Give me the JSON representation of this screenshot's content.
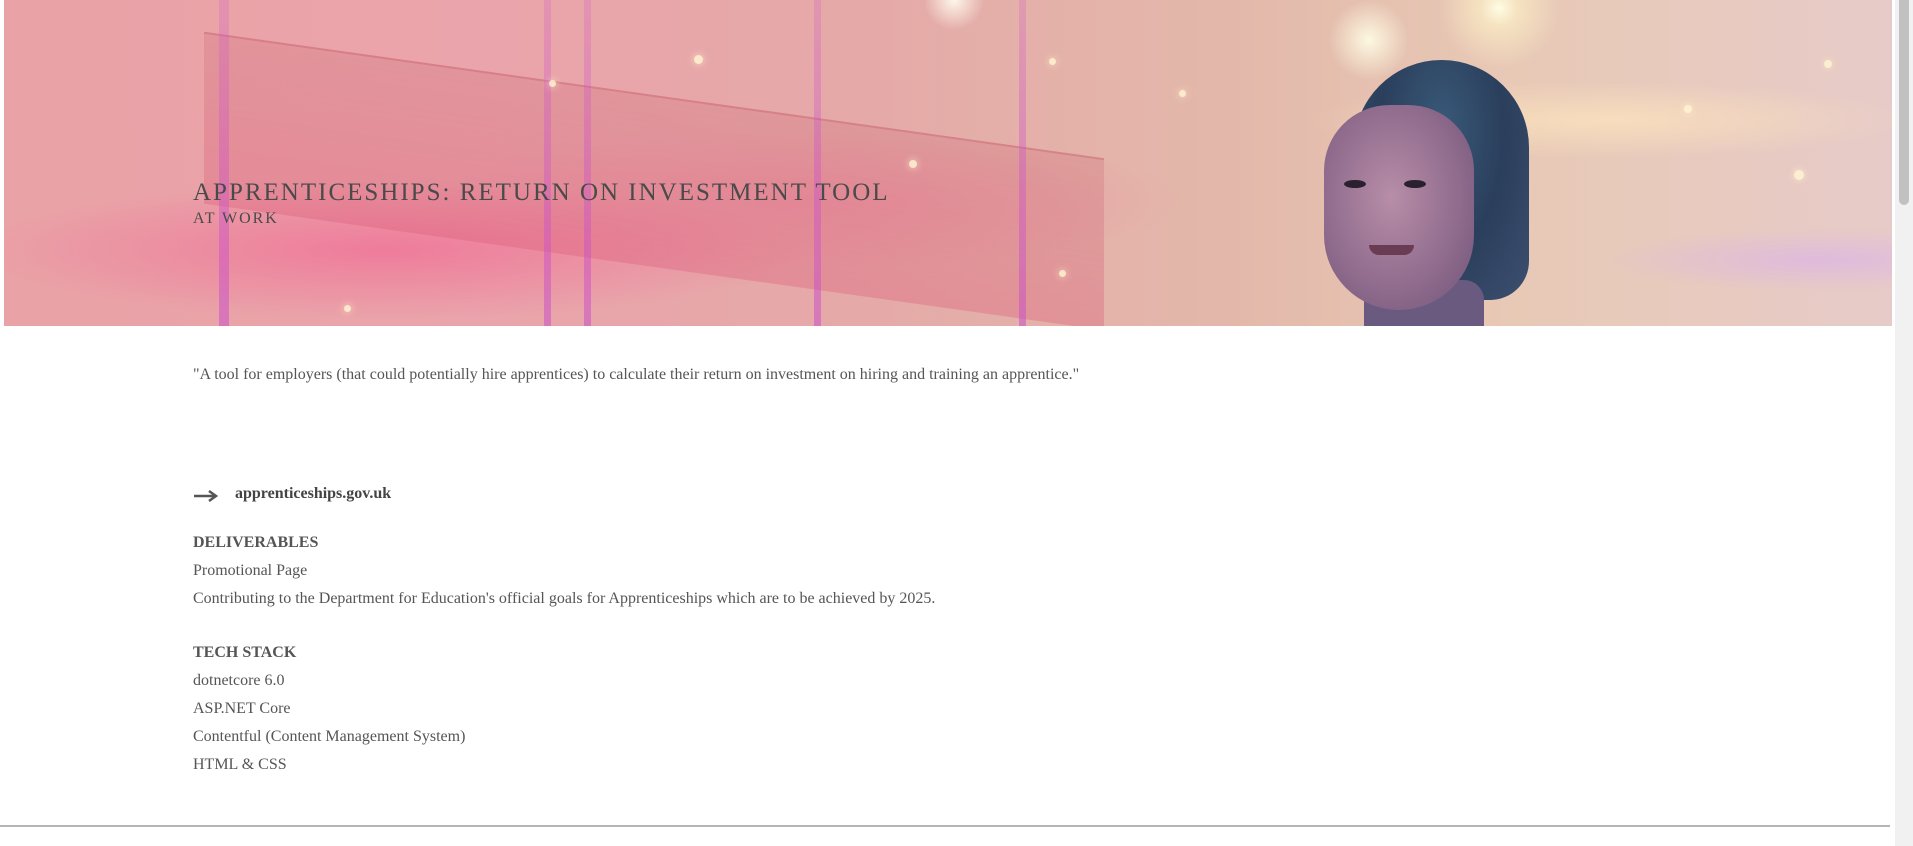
{
  "hero": {
    "title": "APPRENTICESHIPS: RETURN ON INVESTMENT TOOL",
    "subtitle": "AT WORK"
  },
  "main": {
    "quote": "\"A tool for employers (that could potentially hire apprentices) to calculate their return on investment on hiring and training an apprentice.\"",
    "link": {
      "icon": "arrow-right-icon",
      "label": "apprenticeships.gov.uk"
    },
    "deliverables": {
      "heading": "DELIVERABLES",
      "items": [
        "Promotional Page",
        "Contributing to the Department for Education's official goals for Apprenticeships which are to be achieved by 2025."
      ]
    },
    "tech_stack": {
      "heading": "TECH STACK",
      "items": [
        "dotnetcore 6.0",
        "ASP.NET Core",
        "Contentful (Content Management System)",
        "HTML & CSS"
      ]
    }
  }
}
